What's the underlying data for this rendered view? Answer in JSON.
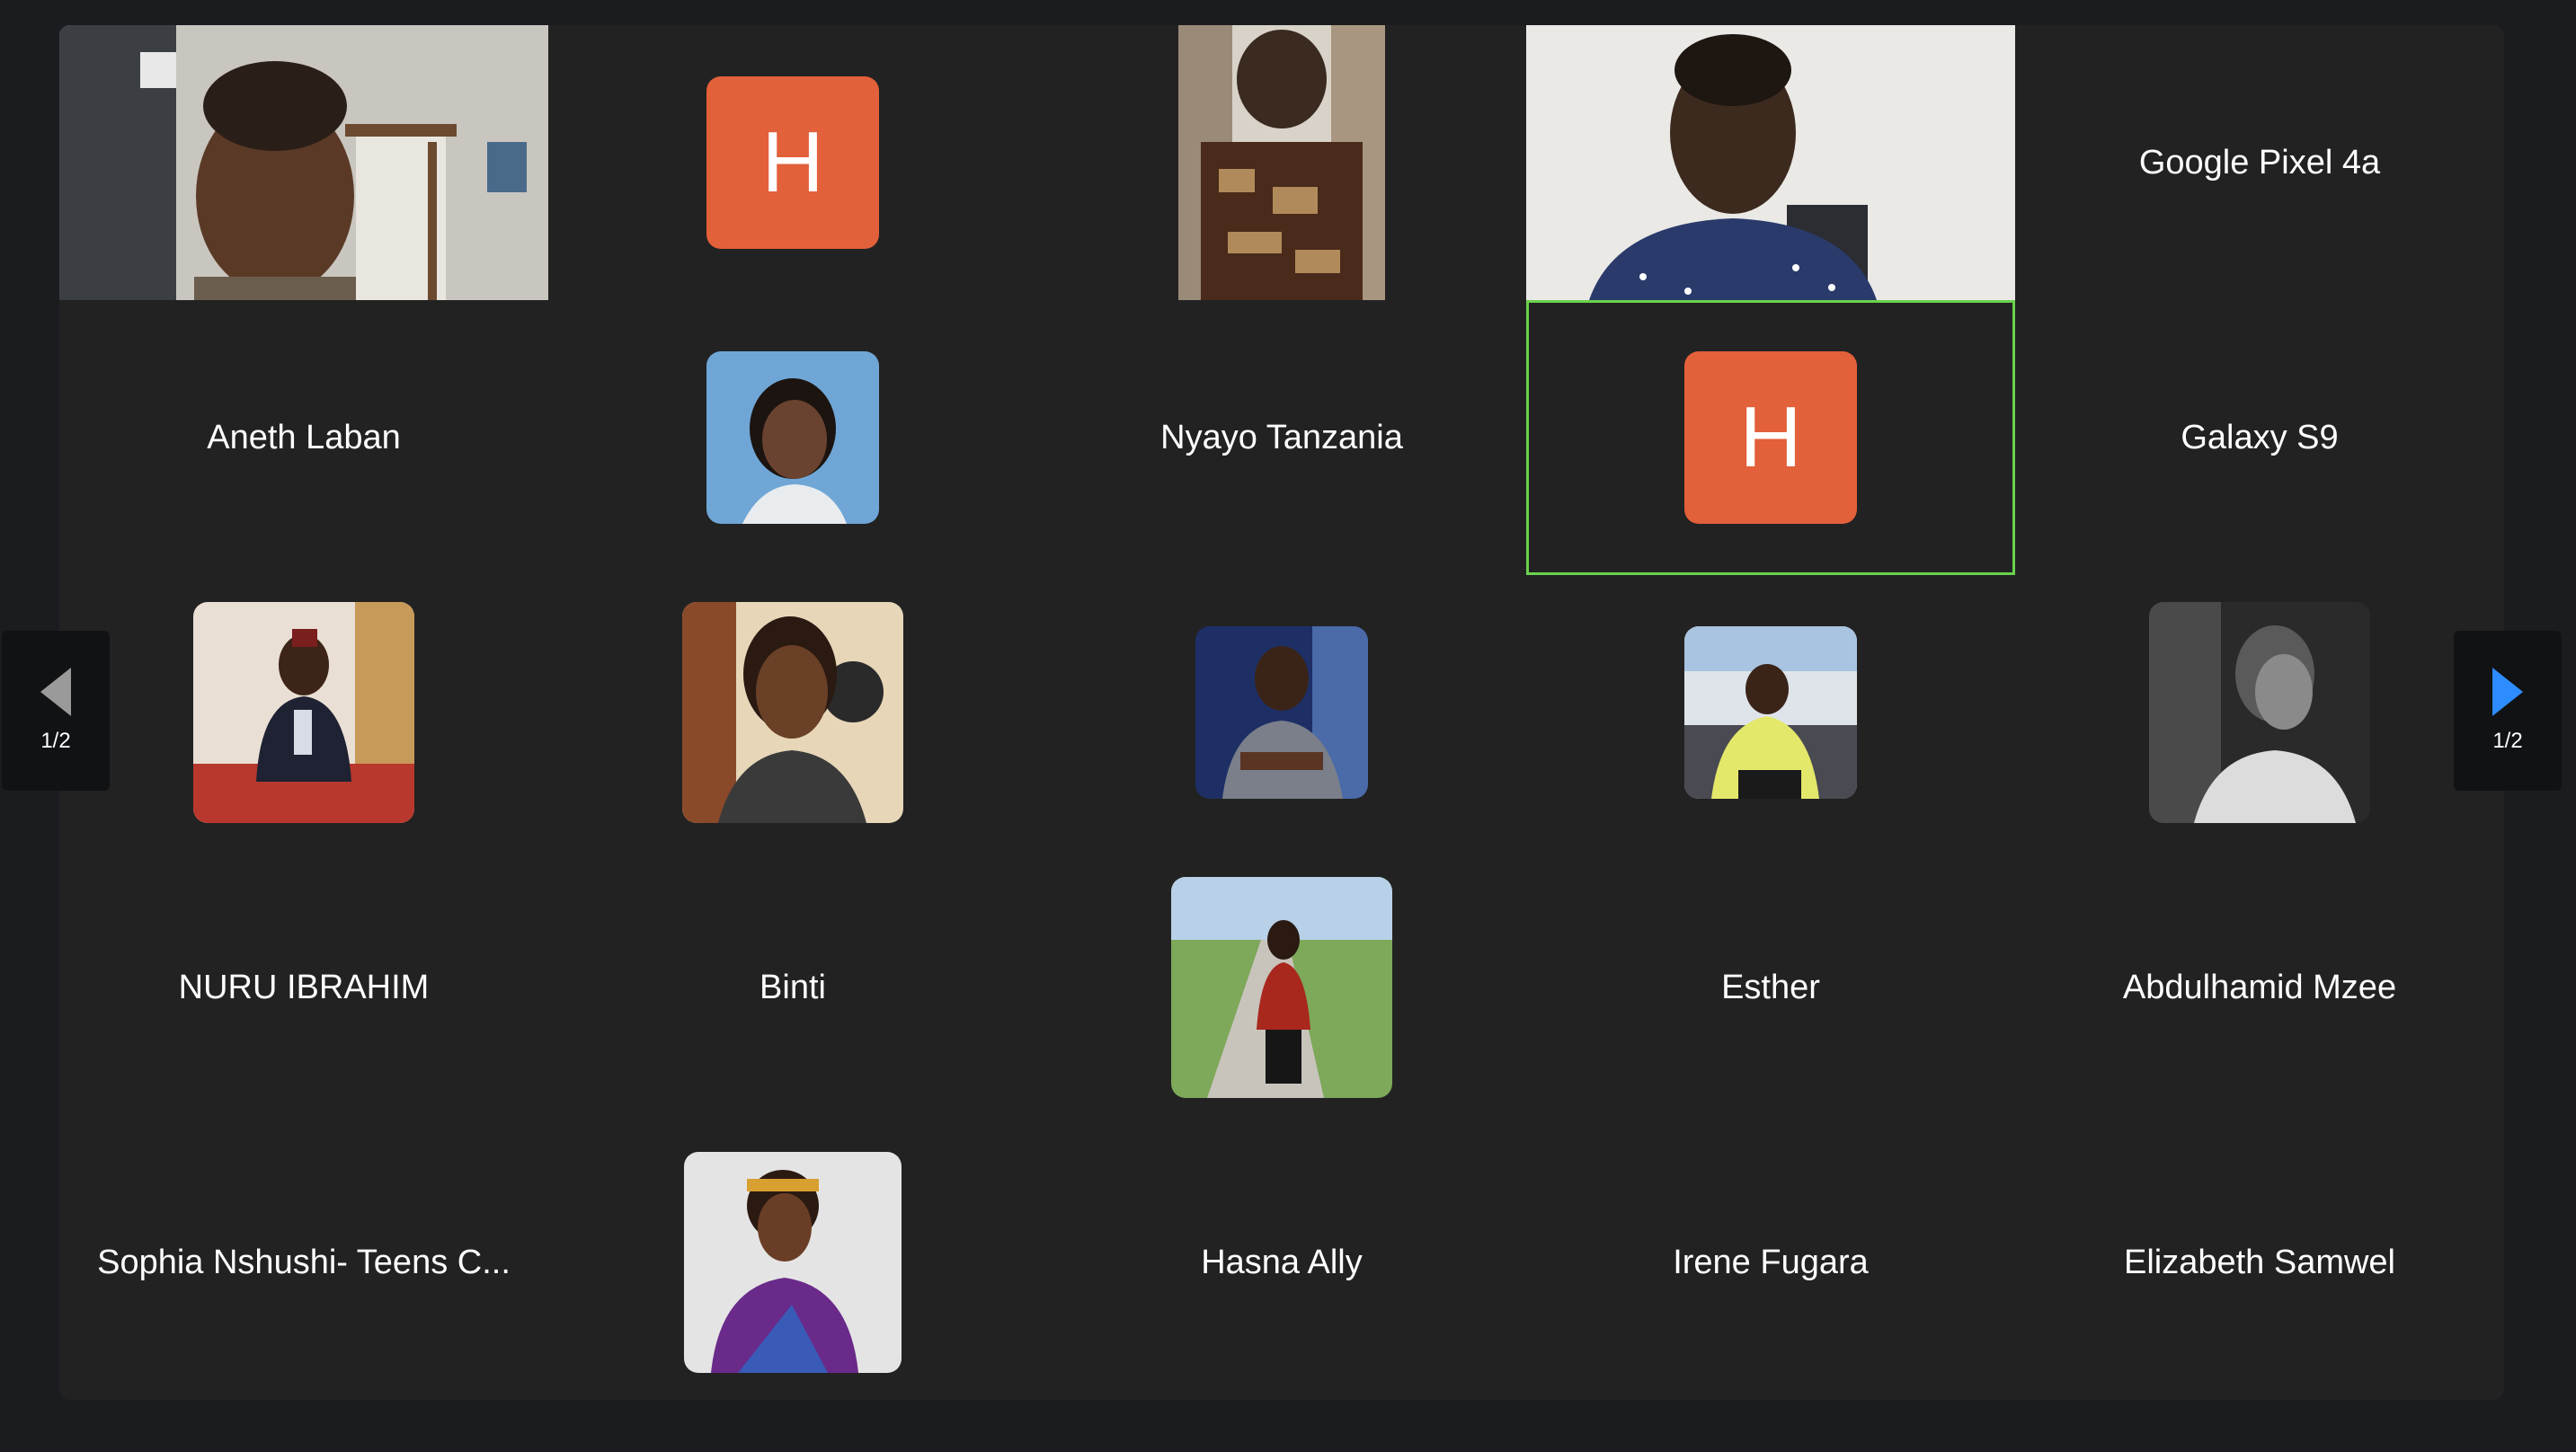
{
  "gallery": {
    "row1": {
      "tile_2_initial": "H",
      "tile_5_name": "Google Pixel 4a"
    },
    "row2": {
      "tile_1_name": "Aneth Laban",
      "tile_3_name": "Nyayo Tanzania",
      "tile_4_initial": "H",
      "tile_5_name": "Galaxy S9"
    },
    "row4": {
      "tile_1_name": "NURU IBRAHIM",
      "tile_2_name": "Binti",
      "tile_4_name": "Esther",
      "tile_5_name": "Abdulhamid Mzee"
    },
    "row5": {
      "tile_1_name": "Sophia Nshushi- Teens C...",
      "tile_3_name": "Hasna Ally",
      "tile_4_name": "Irene Fugara",
      "tile_5_name": "Elizabeth Samwel"
    }
  },
  "navigation": {
    "prev_page": "1/2",
    "next_page": "1/2"
  },
  "colors": {
    "background": "#1b1c1f",
    "gallery_bg": "#222222",
    "avatar_orange": "#e2603a",
    "active_speaker_border": "#6ad24c",
    "next_arrow": "#2d8cff"
  }
}
